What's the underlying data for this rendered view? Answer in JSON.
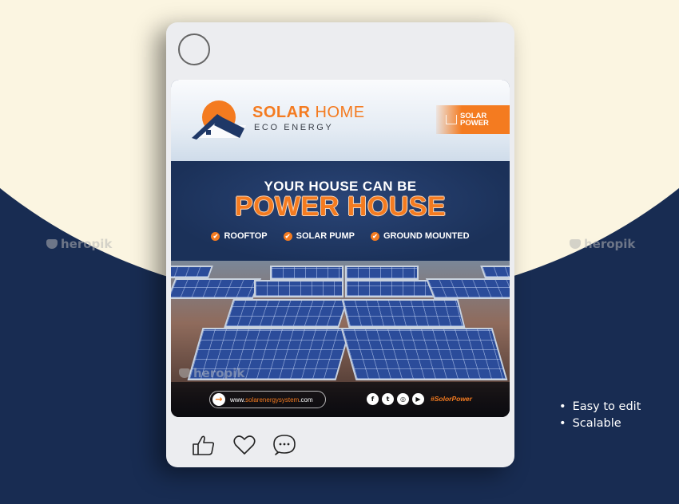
{
  "background": {
    "watermark": "heropik",
    "bullets": [
      "Easy to edit",
      "Scalable"
    ]
  },
  "post": {
    "brand": {
      "title_bold": "SOLAR",
      "title_light": " HOME",
      "subtitle": "ECO ENERGY"
    },
    "badge": {
      "line1": "SOLAR",
      "line2": "POWER"
    },
    "headline": {
      "line1": "YOUR HOUSE CAN BE",
      "line2": "POWER HOUSE"
    },
    "features": [
      "ROOFTOP",
      "SOLAR PUMP",
      "GROUND MOUNTED"
    ],
    "footer": {
      "url_prefix": "www.",
      "url_domain": "solarenergysystem",
      "url_suffix": ".com",
      "socials": [
        "facebook",
        "twitter",
        "instagram",
        "youtube"
      ],
      "hashtag": "#SolorPower"
    },
    "colors": {
      "accent": "#f47b20",
      "navy": "#1b3159"
    }
  },
  "actions": [
    "like",
    "heart",
    "comment"
  ]
}
